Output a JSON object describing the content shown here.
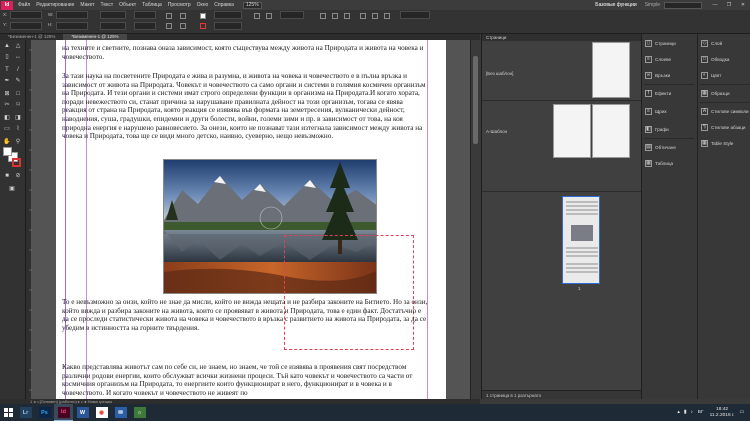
{
  "app": {
    "logo": "Id",
    "menu": [
      "Файл",
      "Редактирование",
      "Макет",
      "Текст",
      "Объект",
      "Таблица",
      "Просмотр",
      "Окно",
      "Справка"
    ],
    "zoom": "125%",
    "workspace_items": [
      "Базовые функции",
      "Simple"
    ],
    "window_buttons": [
      "—",
      "❐",
      "✕"
    ]
  },
  "colors": {
    "accent": "#da1f5d",
    "guide": "#c58bd6",
    "selection": "#e0405a",
    "taskbar": "#1e2a36"
  },
  "document": {
    "tabs": [
      "*Безименен-1 @ 125%",
      "*Безименен-1 @ 125%"
    ],
    "paragraphs": [
      "на техните и светните, познава оназа зависимост, която съществува между живота на Природата и живота на човека и човечеството.",
      "За тази наука на посветените Природата е жива и разумна, и живота на човека и човечеството е в пълна връзка и зависимост от живота на Природата. Човекът и човечеството са само органи и системи в голямия космичен организъм на Природата. И тези органи и системи имат строго определени функции в организма на Природата.И когато хората, поради невежеството си, станат причина за нарушаване правилната дейност на този организъм, тогава се явява реакция от страна на Природата, която реакция се изявява във формата на земетресения, вулканически дейност, наводнения, суша, градушки, епидемии и други болести, войни, големи зими и пр. в зависимост от това, на коя природна енергия е нарушено равновесието. За онези, които не познават тази изтегнала зависимост между живота на човека и Природата, това ще се види много детско, наивно, суеверно, нещо невъзможно.",
      "То е невъзможно за онзи, който не знае да мисли, който не вижда нещата и не разбира законите на Битието. Но за онзи, който вижда и разбира законите на живота, които се проявяват в живота и Природата, това е един факт. Достатъчно е да се проследи статистически живота на човека и човечеството в връзка с развитието на живота на Природата, за да се убедим в истинността на горните твърдения.",
      "Какво представлява животът сам по себе си, не знаем, но знаем, че той се изявява в проявения свят посредством различни родови енергии, които обслужват всички жизнени процеси. Тъй като човекът и човечеството са части от космичния организъм на Природата, то енергиите които функционират в него, функционират и в човека и в човечеството. И когато човекът и човечеството не живеят по"
    ]
  },
  "pages_panel": {
    "title": "Страници",
    "masters": [
      "[Без шаблон]",
      "А-Шаблон"
    ],
    "page_number": "1",
    "footer": "1 страница в 1 разгърнато"
  },
  "side_panels": {
    "col1": [
      "Страници",
      "Слоеве",
      "Връзки",
      "Ефекти",
      "Щрих",
      "Графи",
      "Обтичане",
      "Таблица"
    ],
    "col2": [
      "Слой",
      "Обводка",
      "Цвят",
      "Образци",
      "Стилове символи",
      "Стилове абзаци",
      "Table Style"
    ]
  },
  "status": {
    "text": "1   ◂ ◃   [Основен] (работно)   ▸ ▹   ● Няма грешки"
  },
  "taskbar": {
    "apps": [
      {
        "label": "Lr",
        "bg": "#23405c",
        "fg": "#9cc6ef"
      },
      {
        "label": "Ps",
        "bg": "#0b2646",
        "fg": "#31a8ff"
      },
      {
        "label": "Id",
        "bg": "#49021f",
        "fg": "#ff3f94"
      },
      {
        "label": "W",
        "bg": "#2b579a",
        "fg": "#ffffff"
      },
      {
        "label": "◉",
        "bg": "#ffffff",
        "fg": "#e43b2c"
      },
      {
        "label": "✉",
        "bg": "#2c5ea8",
        "fg": "#ffffff"
      },
      {
        "label": "☼",
        "bg": "#3d7a3a",
        "fg": "#ffffff"
      }
    ],
    "lang": "БГ",
    "time": "18:42",
    "date": "11.2.2016 г."
  }
}
